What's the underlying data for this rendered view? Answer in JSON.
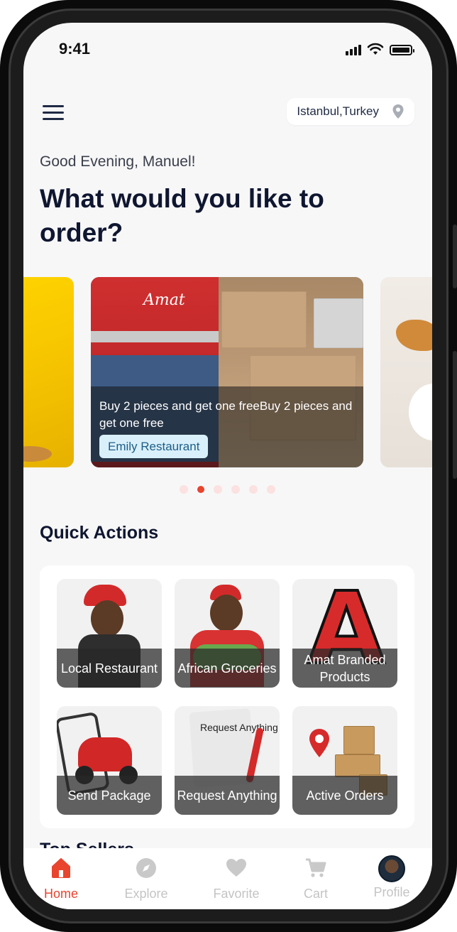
{
  "status_bar": {
    "time": "9:41"
  },
  "header": {
    "location": "Istanbul,Turkey"
  },
  "greeting": "Good Evening, Manuel!",
  "headline": "What would you like to order?",
  "carousel": {
    "card_brand": "Amat",
    "promo_text": "Buy 2 pieces and get one freeBuy 2 pieces and get one free",
    "promo_tag": "Emily Restaurant",
    "dots_total": 6,
    "active_dot": 2
  },
  "quick_actions": {
    "title": "Quick Actions",
    "items": [
      {
        "label": "Local Restaurant"
      },
      {
        "label": "African Groceries"
      },
      {
        "label": "Amat Branded Products"
      },
      {
        "label": "Send Package"
      },
      {
        "label": "Request Anything"
      },
      {
        "label": "Active Orders"
      }
    ],
    "note_text": "Request Anything"
  },
  "next_section_title": "Top Sellers",
  "tabbar": {
    "items": [
      {
        "label": "Home",
        "icon": "home-icon",
        "active": true
      },
      {
        "label": "Explore",
        "icon": "compass-icon",
        "active": false
      },
      {
        "label": "Favorite",
        "icon": "heart-icon",
        "active": false
      },
      {
        "label": "Cart",
        "icon": "cart-icon",
        "active": false
      },
      {
        "label": "Profile",
        "icon": "avatar",
        "active": false
      }
    ]
  },
  "colors": {
    "accent": "#e8442e",
    "text": "#0f1630",
    "tag_bg": "#d9f0fb"
  }
}
